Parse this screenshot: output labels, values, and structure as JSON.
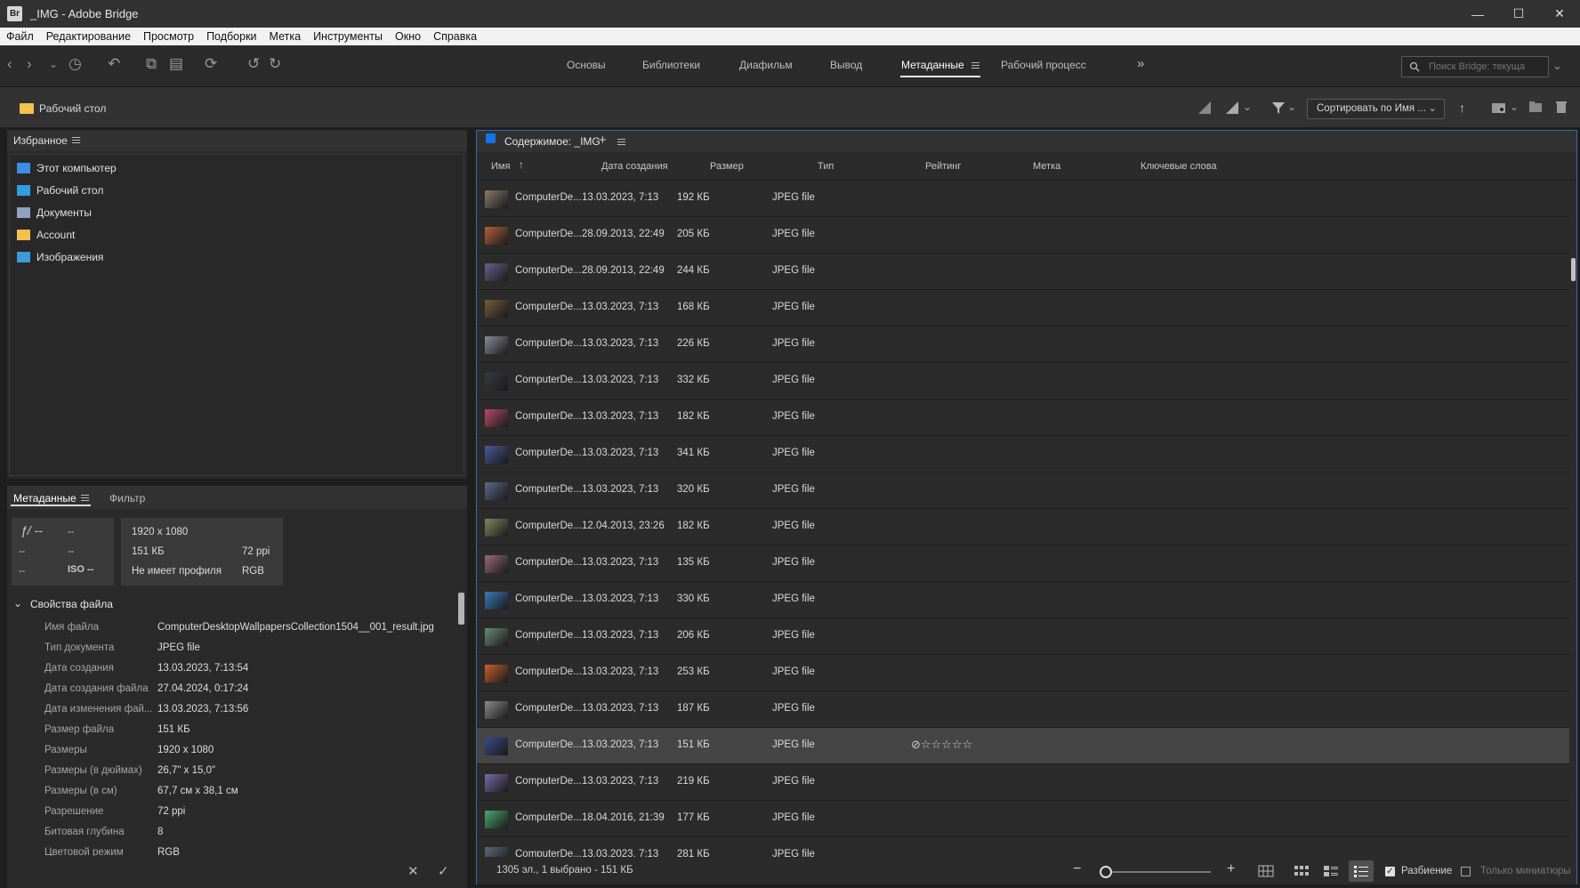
{
  "window": {
    "badge": "Br",
    "title": "_IMG - Adobe Bridge",
    "minimize": "—",
    "maximize": "☐",
    "close": "✕"
  },
  "menu": [
    "Файл",
    "Редактирование",
    "Просмотр",
    "Подборки",
    "Метка",
    "Инструменты",
    "Окно",
    "Справка"
  ],
  "workspaces": {
    "tabs": [
      "Основы",
      "Библиотеки",
      "Диафильм",
      "Вывод",
      "Метаданные",
      "Рабочий процесс"
    ],
    "active": "Метаданные",
    "more": "»"
  },
  "search": {
    "placeholder": "Поиск Bridge: текуща"
  },
  "path": {
    "location": "Рабочий стол"
  },
  "sort": {
    "label": "Сортировать по Имя ..."
  },
  "favorites": {
    "title": "Избранное",
    "items": [
      {
        "label": "Этот компьютер",
        "icon": "computer-icon",
        "color": "#3a8ee6"
      },
      {
        "label": "Рабочий стол",
        "icon": "desktop-icon",
        "color": "#2f9fe0"
      },
      {
        "label": "Документы",
        "icon": "documents-icon",
        "color": "#8da3bd"
      },
      {
        "label": "Account",
        "icon": "folder-icon",
        "color": "#f2c14e"
      },
      {
        "label": "Изображения",
        "icon": "pictures-icon",
        "color": "#3d9ad6"
      }
    ]
  },
  "metadata": {
    "tab_active": "Метаданные",
    "tab_filter": "Фильтр",
    "camera": {
      "aperture": "ƒ/ --",
      "shutter": "--",
      "r2a": "--",
      "r2b": "--",
      "r3a": "--",
      "iso": "ISO --"
    },
    "info": {
      "dimensions": "1920 x 1080",
      "filesize": "151 КБ",
      "resolution": "72 ppi",
      "profile": "Не имеет профиля",
      "colormode": "RGB"
    },
    "section_title": "Свойства файла",
    "properties": [
      {
        "label": "Имя файла",
        "value": "ComputerDesktopWallpapersCollection1504__001_result.jpg"
      },
      {
        "label": "Тип документа",
        "value": "JPEG file"
      },
      {
        "label": "Дата создания",
        "value": "13.03.2023, 7:13:54"
      },
      {
        "label": "Дата создания файла",
        "value": "27.04.2024, 0:17:24"
      },
      {
        "label": "Дата изменения фай...",
        "value": "13.03.2023, 7:13:56"
      },
      {
        "label": "Размер файла",
        "value": "151 КБ"
      },
      {
        "label": "Размеры",
        "value": "1920 x 1080"
      },
      {
        "label": "Размеры (в дюймах)",
        "value": "26,7\" x 15,0\""
      },
      {
        "label": "Размеры (в см)",
        "value": "67,7 см x 38,1 см"
      },
      {
        "label": "Разрешение",
        "value": "72 ppi"
      },
      {
        "label": "Битовая глубина",
        "value": "8"
      },
      {
        "label": "Цветовой режим",
        "value": "RGB"
      }
    ],
    "cancel": "✕",
    "apply": "✓"
  },
  "content": {
    "title": "Содержимое: _IMG",
    "add": "+",
    "columns": [
      "Имя",
      "Дата создания",
      "Размер",
      "Тип",
      "Рейтинг",
      "Метка",
      "Ключевые слова"
    ],
    "sort_arrow": "↑",
    "rows": [
      {
        "name": "ComputerDe...",
        "date": "13.03.2023, 7:13",
        "size": "192 КБ",
        "type": "JPEG file",
        "thumb": "#8a7a6a"
      },
      {
        "name": "ComputerDe...",
        "date": "28.09.2013, 22:49",
        "size": "205 КБ",
        "type": "JPEG file",
        "thumb": "#b5603a"
      },
      {
        "name": "ComputerDe...",
        "date": "28.09.2013, 22:49",
        "size": "244 КБ",
        "type": "JPEG file",
        "thumb": "#6a5f8c"
      },
      {
        "name": "ComputerDe...",
        "date": "13.03.2023, 7:13",
        "size": "168 КБ",
        "type": "JPEG file",
        "thumb": "#7a5a3a"
      },
      {
        "name": "ComputerDe...",
        "date": "13.03.2023, 7:13",
        "size": "226 КБ",
        "type": "JPEG file",
        "thumb": "#8a8a9a"
      },
      {
        "name": "ComputerDe...",
        "date": "13.03.2023, 7:13",
        "size": "332 КБ",
        "type": "JPEG file",
        "thumb": "#3a3a4a"
      },
      {
        "name": "ComputerDe...",
        "date": "13.03.2023, 7:13",
        "size": "182 КБ",
        "type": "JPEG file",
        "thumb": "#b84a6a"
      },
      {
        "name": "ComputerDe...",
        "date": "13.03.2023, 7:13",
        "size": "341 КБ",
        "type": "JPEG file",
        "thumb": "#4a5a9a"
      },
      {
        "name": "ComputerDe...",
        "date": "13.03.2023, 7:13",
        "size": "320 КБ",
        "type": "JPEG file",
        "thumb": "#5a6a8a"
      },
      {
        "name": "ComputerDe...",
        "date": "12.04.2013, 23:26",
        "size": "182 КБ",
        "type": "JPEG file",
        "thumb": "#7a8a5a"
      },
      {
        "name": "ComputerDe...",
        "date": "13.03.2023, 7:13",
        "size": "135 КБ",
        "type": "JPEG file",
        "thumb": "#9a6a7a"
      },
      {
        "name": "ComputerDe...",
        "date": "13.03.2023, 7:13",
        "size": "330 КБ",
        "type": "JPEG file",
        "thumb": "#3a7ab8"
      },
      {
        "name": "ComputerDe...",
        "date": "13.03.2023, 7:13",
        "size": "206 КБ",
        "type": "JPEG file",
        "thumb": "#6a8a7a"
      },
      {
        "name": "ComputerDe...",
        "date": "13.03.2023, 7:13",
        "size": "253 КБ",
        "type": "JPEG file",
        "thumb": "#c8602a"
      },
      {
        "name": "ComputerDe...",
        "date": "13.03.2023, 7:13",
        "size": "187 КБ",
        "type": "JPEG file",
        "thumb": "#8a8a8a"
      },
      {
        "name": "ComputerDe...",
        "date": "13.03.2023, 7:13",
        "size": "151 КБ",
        "type": "JPEG file",
        "thumb": "#3a4a8a",
        "selected": true,
        "rating": "⊘☆☆☆☆☆"
      },
      {
        "name": "ComputerDe...",
        "date": "13.03.2023, 7:13",
        "size": "219 КБ",
        "type": "JPEG file",
        "thumb": "#7a6aa8"
      },
      {
        "name": "ComputerDe...",
        "date": "18.04.2016, 21:39",
        "size": "177 КБ",
        "type": "JPEG file",
        "thumb": "#4aa86a"
      },
      {
        "name": "ComputerDe...",
        "date": "13.03.2023, 7:13",
        "size": "281 КБ",
        "type": "JPEG file",
        "thumb": "#5a6a7a"
      }
    ]
  },
  "status": {
    "text": "1305 эл., 1 выбрано - 151 КБ",
    "zoom_minus": "−",
    "zoom_plus": "+",
    "split_label": "Разбиение",
    "split_checked": true,
    "thumbs_only_label": "Только миниатюры",
    "thumbs_only_checked": false
  }
}
